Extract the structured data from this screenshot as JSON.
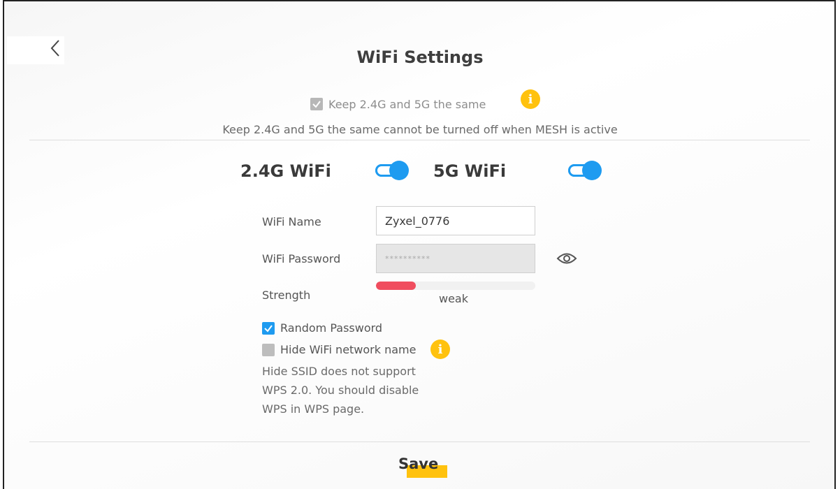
{
  "page": {
    "title": "WiFi Settings"
  },
  "keep_same": {
    "label": "Keep 2.4G and 5G the same",
    "checked": true,
    "note": "Keep 2.4G and 5G the same cannot be turned off when MESH is active"
  },
  "bands": {
    "band24": {
      "label": "2.4G WiFi",
      "enabled": true
    },
    "band5": {
      "label": "5G WiFi",
      "enabled": true
    }
  },
  "form": {
    "name_label": "WiFi Name",
    "name_value": "Zyxel_0776",
    "password_label": "WiFi Password",
    "password_value": "**********",
    "strength_label": "Strength",
    "strength_text": "weak",
    "strength_fraction": 0.25
  },
  "options": {
    "random_password_label": "Random Password",
    "random_password_checked": true,
    "hide_ssid_label": "Hide WiFi network name",
    "hide_ssid_checked": false,
    "hide_note_lines": [
      "Hide SSID does not support",
      "WPS 2.0. You should disable",
      "WPS in WPS page."
    ]
  },
  "actions": {
    "save_label": "Save"
  },
  "icons": {
    "back": "chevron-left-icon",
    "info": "info-icon",
    "eye": "eye-icon",
    "check": "checkmark-icon"
  },
  "colors": {
    "accent_blue": "#1e9bf0",
    "info_yellow": "#ffc20e",
    "weak_red": "#f04d5e"
  }
}
